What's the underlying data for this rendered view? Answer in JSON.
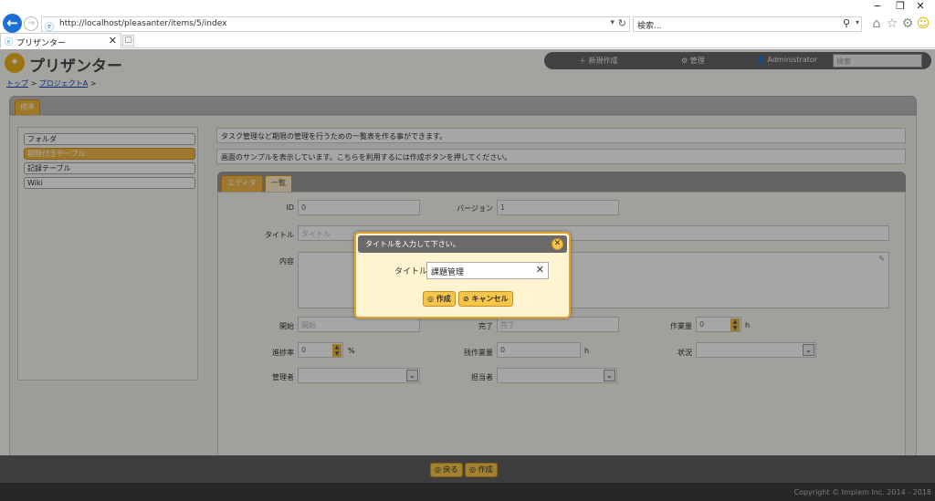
{
  "browser": {
    "window_controls": {
      "minimize": "−",
      "restore": "❐",
      "close": "✕"
    },
    "url": "http://localhost/pleasanter/items/5/index",
    "search_placeholder": "検索...",
    "tab_title": "プリザンター",
    "tab_close": "✕"
  },
  "app": {
    "logo_text": "プリザンター",
    "topnav": {
      "new": "＋ 新規作成",
      "manage": "⚙ 管理",
      "user": "👤 Administrator",
      "search_placeholder": "検索"
    },
    "breadcrumb": [
      {
        "label": "トップ"
      },
      {
        "label": "プロジェクトA"
      }
    ],
    "breadcrumb_sep": ">",
    "header_tab": "標準",
    "sidebar": [
      {
        "label": "フォルダ",
        "active": false
      },
      {
        "label": "期限付きテーブル",
        "active": true
      },
      {
        "label": "記録テーブル",
        "active": false
      },
      {
        "label": "Wiki",
        "active": false
      }
    ],
    "info_lines": [
      "タスク管理など期限の管理を行うための一覧表を作る事ができます。",
      "画面のサンプルを表示しています。こちらを利用するには作成ボタンを押してください。"
    ],
    "editor_tabs": {
      "editor": "エディタ",
      "list": "一覧"
    },
    "form": {
      "id_label": "ID",
      "id_value": "0",
      "version_label": "バージョン",
      "version_value": "1",
      "title_label": "タイトル",
      "title_placeholder": "タイトル",
      "content_label": "内容",
      "start_label": "開始",
      "start_placeholder": "開始",
      "end_label": "完了",
      "end_placeholder": "完了",
      "work_value_label": "作業量",
      "work_value": "0",
      "work_unit": "h",
      "progress_label": "進捗率",
      "progress_value": "0",
      "progress_unit": "%",
      "remaining_label": "残作業量",
      "remaining_value": "0",
      "remaining_unit": "h",
      "status_label": "状況",
      "manager_label": "管理者",
      "owner_label": "担当者"
    },
    "bottom_buttons": {
      "back": "◎ 戻る",
      "create": "◎ 作成"
    },
    "copyright": "Copyright © Implem Inc. 2014 - 2018"
  },
  "dialog": {
    "title": "タイトルを入力して下さい。",
    "label": "タイトル",
    "input_value": "課題管理",
    "clear_glyph": "✕",
    "create_button": "◎ 作成",
    "cancel_button": "⊘ キャンセル",
    "close_glyph": "✕"
  }
}
